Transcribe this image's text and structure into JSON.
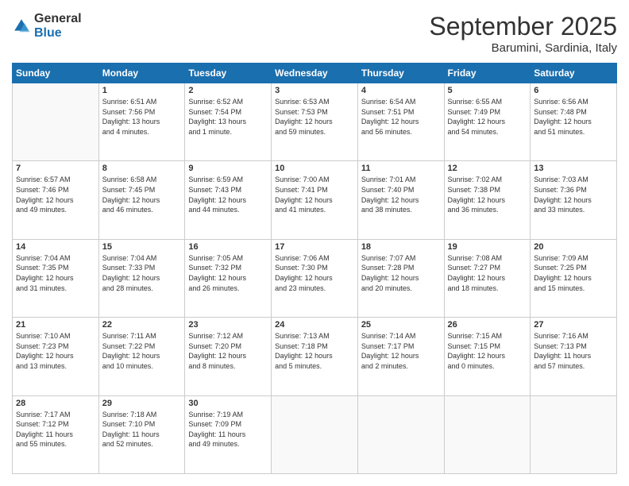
{
  "logo": {
    "general": "General",
    "blue": "Blue"
  },
  "header": {
    "month": "September 2025",
    "location": "Barumini, Sardinia, Italy"
  },
  "weekdays": [
    "Sunday",
    "Monday",
    "Tuesday",
    "Wednesday",
    "Thursday",
    "Friday",
    "Saturday"
  ],
  "weeks": [
    [
      {
        "day": "",
        "info": ""
      },
      {
        "day": "1",
        "info": "Sunrise: 6:51 AM\nSunset: 7:56 PM\nDaylight: 13 hours\nand 4 minutes."
      },
      {
        "day": "2",
        "info": "Sunrise: 6:52 AM\nSunset: 7:54 PM\nDaylight: 13 hours\nand 1 minute."
      },
      {
        "day": "3",
        "info": "Sunrise: 6:53 AM\nSunset: 7:53 PM\nDaylight: 12 hours\nand 59 minutes."
      },
      {
        "day": "4",
        "info": "Sunrise: 6:54 AM\nSunset: 7:51 PM\nDaylight: 12 hours\nand 56 minutes."
      },
      {
        "day": "5",
        "info": "Sunrise: 6:55 AM\nSunset: 7:49 PM\nDaylight: 12 hours\nand 54 minutes."
      },
      {
        "day": "6",
        "info": "Sunrise: 6:56 AM\nSunset: 7:48 PM\nDaylight: 12 hours\nand 51 minutes."
      }
    ],
    [
      {
        "day": "7",
        "info": "Sunrise: 6:57 AM\nSunset: 7:46 PM\nDaylight: 12 hours\nand 49 minutes."
      },
      {
        "day": "8",
        "info": "Sunrise: 6:58 AM\nSunset: 7:45 PM\nDaylight: 12 hours\nand 46 minutes."
      },
      {
        "day": "9",
        "info": "Sunrise: 6:59 AM\nSunset: 7:43 PM\nDaylight: 12 hours\nand 44 minutes."
      },
      {
        "day": "10",
        "info": "Sunrise: 7:00 AM\nSunset: 7:41 PM\nDaylight: 12 hours\nand 41 minutes."
      },
      {
        "day": "11",
        "info": "Sunrise: 7:01 AM\nSunset: 7:40 PM\nDaylight: 12 hours\nand 38 minutes."
      },
      {
        "day": "12",
        "info": "Sunrise: 7:02 AM\nSunset: 7:38 PM\nDaylight: 12 hours\nand 36 minutes."
      },
      {
        "day": "13",
        "info": "Sunrise: 7:03 AM\nSunset: 7:36 PM\nDaylight: 12 hours\nand 33 minutes."
      }
    ],
    [
      {
        "day": "14",
        "info": "Sunrise: 7:04 AM\nSunset: 7:35 PM\nDaylight: 12 hours\nand 31 minutes."
      },
      {
        "day": "15",
        "info": "Sunrise: 7:04 AM\nSunset: 7:33 PM\nDaylight: 12 hours\nand 28 minutes."
      },
      {
        "day": "16",
        "info": "Sunrise: 7:05 AM\nSunset: 7:32 PM\nDaylight: 12 hours\nand 26 minutes."
      },
      {
        "day": "17",
        "info": "Sunrise: 7:06 AM\nSunset: 7:30 PM\nDaylight: 12 hours\nand 23 minutes."
      },
      {
        "day": "18",
        "info": "Sunrise: 7:07 AM\nSunset: 7:28 PM\nDaylight: 12 hours\nand 20 minutes."
      },
      {
        "day": "19",
        "info": "Sunrise: 7:08 AM\nSunset: 7:27 PM\nDaylight: 12 hours\nand 18 minutes."
      },
      {
        "day": "20",
        "info": "Sunrise: 7:09 AM\nSunset: 7:25 PM\nDaylight: 12 hours\nand 15 minutes."
      }
    ],
    [
      {
        "day": "21",
        "info": "Sunrise: 7:10 AM\nSunset: 7:23 PM\nDaylight: 12 hours\nand 13 minutes."
      },
      {
        "day": "22",
        "info": "Sunrise: 7:11 AM\nSunset: 7:22 PM\nDaylight: 12 hours\nand 10 minutes."
      },
      {
        "day": "23",
        "info": "Sunrise: 7:12 AM\nSunset: 7:20 PM\nDaylight: 12 hours\nand 8 minutes."
      },
      {
        "day": "24",
        "info": "Sunrise: 7:13 AM\nSunset: 7:18 PM\nDaylight: 12 hours\nand 5 minutes."
      },
      {
        "day": "25",
        "info": "Sunrise: 7:14 AM\nSunset: 7:17 PM\nDaylight: 12 hours\nand 2 minutes."
      },
      {
        "day": "26",
        "info": "Sunrise: 7:15 AM\nSunset: 7:15 PM\nDaylight: 12 hours\nand 0 minutes."
      },
      {
        "day": "27",
        "info": "Sunrise: 7:16 AM\nSunset: 7:13 PM\nDaylight: 11 hours\nand 57 minutes."
      }
    ],
    [
      {
        "day": "28",
        "info": "Sunrise: 7:17 AM\nSunset: 7:12 PM\nDaylight: 11 hours\nand 55 minutes."
      },
      {
        "day": "29",
        "info": "Sunrise: 7:18 AM\nSunset: 7:10 PM\nDaylight: 11 hours\nand 52 minutes."
      },
      {
        "day": "30",
        "info": "Sunrise: 7:19 AM\nSunset: 7:09 PM\nDaylight: 11 hours\nand 49 minutes."
      },
      {
        "day": "",
        "info": ""
      },
      {
        "day": "",
        "info": ""
      },
      {
        "day": "",
        "info": ""
      },
      {
        "day": "",
        "info": ""
      }
    ]
  ]
}
